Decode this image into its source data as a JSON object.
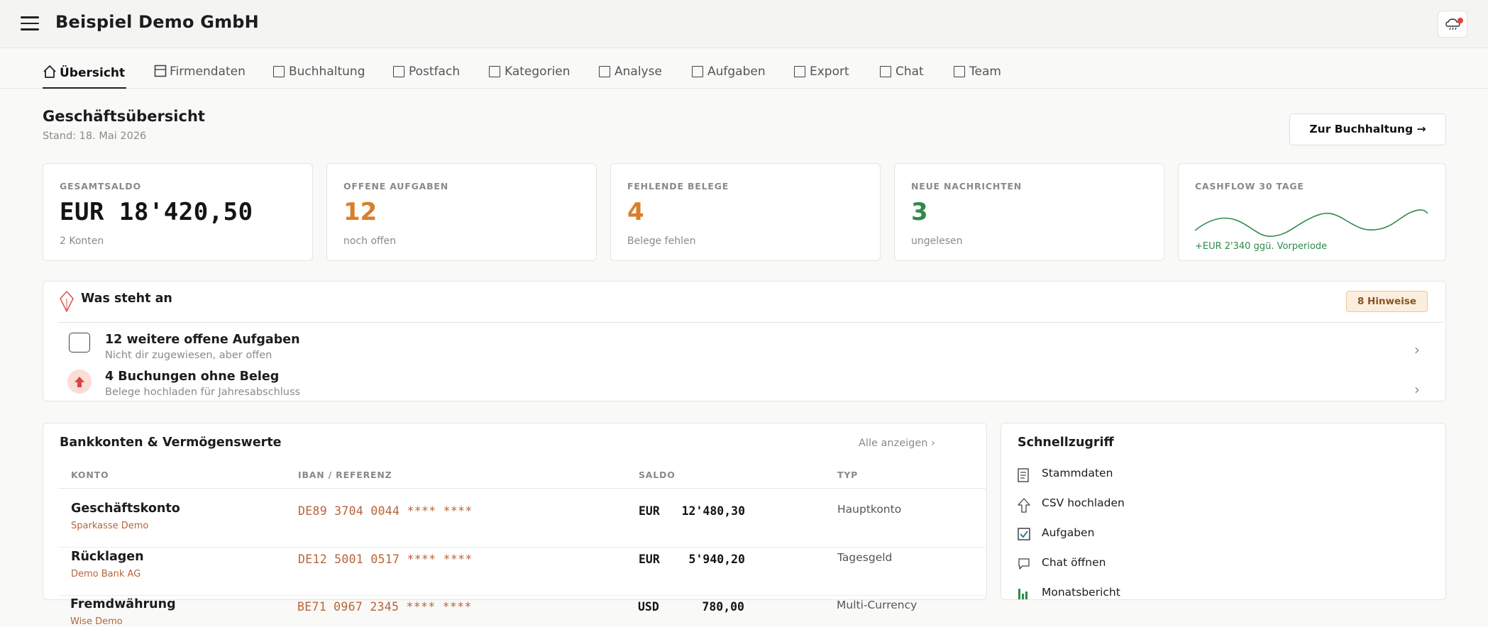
{
  "header": {
    "title": "Beispiel Demo GmbH",
    "menu_icon": "hamburger-icon",
    "notification_icon": "cloud-notification-icon"
  },
  "tabs": [
    {
      "label": "Übersicht",
      "icon": "home-icon",
      "active": true
    },
    {
      "label": "Firmendaten",
      "icon": "document-icon"
    },
    {
      "label": "Buchhaltung",
      "icon": "checkbox-icon"
    },
    {
      "label": "Postfach",
      "icon": "checkbox-icon"
    },
    {
      "label": "Kategorien",
      "icon": "checkbox-icon"
    },
    {
      "label": "Analyse",
      "icon": "checkbox-icon"
    },
    {
      "label": "Aufgaben",
      "icon": "checkbox-icon"
    },
    {
      "label": "Export",
      "icon": "checkbox-icon"
    },
    {
      "label": "Chat",
      "icon": "checkbox-icon"
    },
    {
      "label": "Team",
      "icon": "checkbox-icon"
    }
  ],
  "overview": {
    "title": "Geschäftsübersicht",
    "subtitle": "Stand: 18. Mai 2026",
    "action_label": "Zur Buchhaltung  →"
  },
  "kpis": [
    {
      "label": "GESAMTSALDO",
      "value": "EUR 18'420,50",
      "note": "2 Konten",
      "color": "#141414"
    },
    {
      "label": "OFFENE AUFGABEN",
      "value": "12",
      "note": "noch offen",
      "color": "#d97e2a"
    },
    {
      "label": "FEHLENDE BELEGE",
      "value": "4",
      "note": "Belege fehlen",
      "color": "#d97e2a"
    },
    {
      "label": "NEUE NACHRICHTEN",
      "value": "3",
      "note": "ungelesen",
      "color": "#2e8a4c"
    },
    {
      "label": "CASHFLOW 30 TAGE",
      "note": "+EUR 2'340 ggü. Vorperiode",
      "color": "#2e8a4c"
    }
  ],
  "todos": {
    "title": "Was steht an",
    "badge": "8 Hinweise",
    "items": [
      {
        "title": "12 weitere offene Aufgaben",
        "subtitle": "Nicht dir zugewiesen, aber offen",
        "icon": "checkbox-icon"
      },
      {
        "title": "4 Buchungen ohne Beleg",
        "subtitle": "Belege hochladen für Jahresabschluss",
        "icon": "upload-arrow-icon"
      }
    ],
    "chevron": "›"
  },
  "bank": {
    "title": "Bankkonten & Vermögenswerte",
    "link": "Alle anzeigen  ›",
    "columns": [
      "KONTO",
      "IBAN / REFERENZ",
      "SALDO",
      "TYP"
    ],
    "rows": [
      {
        "name": "Geschäftskonto",
        "bank": "Sparkasse Demo",
        "iban": "DE89 3704 0044 **** ****",
        "currency": "EUR",
        "amount": "12'480,30",
        "type": "Hauptkonto"
      },
      {
        "name": "Rücklagen",
        "bank": "Demo Bank AG",
        "iban": "DE12 5001 0517 **** ****",
        "currency": "EUR",
        "amount": "5'940,20",
        "type": "Tagesgeld"
      },
      {
        "name": "Fremdwährung",
        "bank": "Wise Demo",
        "iban": "BE71 0967 2345 **** ****",
        "currency": "USD",
        "amount": "780,00",
        "type": "Multi-Currency"
      }
    ]
  },
  "quick": {
    "title": "Schnellzugriff",
    "items": [
      {
        "label": "Stammdaten",
        "icon": "document-icon"
      },
      {
        "label": "CSV hochladen",
        "icon": "upload-arrow-icon"
      },
      {
        "label": "Aufgaben",
        "icon": "checked-box-icon"
      },
      {
        "label": "Chat öffnen",
        "icon": "chat-bubble-icon"
      },
      {
        "label": "Monatsbericht",
        "icon": "bar-chart-icon"
      }
    ]
  }
}
